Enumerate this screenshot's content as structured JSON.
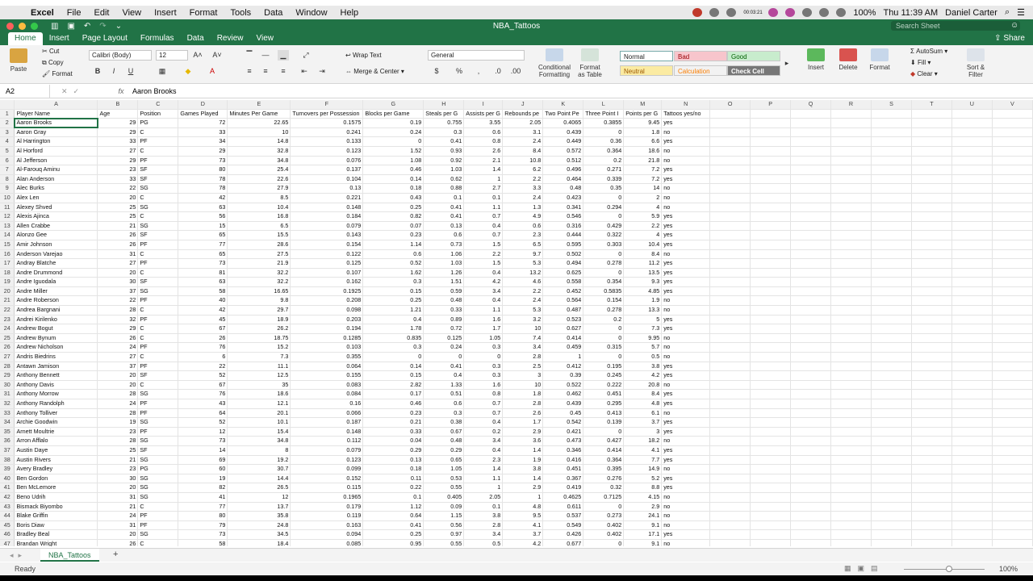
{
  "menubar": {
    "apple": "",
    "app": "Excel",
    "items": [
      "File",
      "Edit",
      "View",
      "Insert",
      "Format",
      "Tools",
      "Data",
      "Window",
      "Help"
    ],
    "battery": "100%",
    "time": "Thu 11:39 AM",
    "user": "Daniel Carter",
    "status_text": "00:03:21"
  },
  "titlebar": {
    "title": "NBA_Tattoos",
    "search_placeholder": "Search Sheet"
  },
  "ribbon_tabs": {
    "items": [
      "Home",
      "Insert",
      "Page Layout",
      "Formulas",
      "Data",
      "Review",
      "View"
    ],
    "share": "Share"
  },
  "ribbon": {
    "paste": "Paste",
    "cut": "Cut",
    "copy": "Copy",
    "format": "Format",
    "font": "Calibri (Body)",
    "size": "12",
    "bold": "B",
    "italic": "I",
    "underline": "U",
    "wrap": "Wrap Text",
    "merge": "Merge & Center",
    "number_format": "General",
    "currency": "$",
    "percent": "%",
    "comma": ",",
    "cond": "Conditional\nFormatting",
    "fmt_table": "Format\nas Table",
    "styles": {
      "normal": "Normal",
      "bad": "Bad",
      "good": "Good",
      "neutral": "Neutral",
      "calculation": "Calculation",
      "check": "Check Cell"
    },
    "insert": "Insert",
    "delete": "Delete",
    "format_cells": "Format",
    "autosum": "AutoSum",
    "fill": "Fill",
    "clear": "Clear",
    "sort": "Sort &\nFilter",
    "colors": {
      "accent": "#217346",
      "bad_bg": "#f7c5cc",
      "good_bg": "#c8eccd",
      "neutral_bg": "#fbeba2",
      "check_bg": "#777777"
    }
  },
  "formula_bar": {
    "name_box": "A2",
    "fx": "fx",
    "value": "Aaron Brooks"
  },
  "grid": {
    "columns": [
      "A",
      "B",
      "C",
      "D",
      "E",
      "F",
      "G",
      "H",
      "I",
      "J",
      "K",
      "L",
      "M",
      "N",
      "O",
      "P",
      "Q",
      "R",
      "S",
      "T",
      "U",
      "V"
    ],
    "header": [
      "Player Name",
      "Age",
      "Position",
      "Games Played",
      "Minutes Per Game",
      "Turnovers per Possession",
      "Blocks per Game",
      "Steals per G",
      "Assists per G",
      "Rebounds pe",
      "Two Point Pe",
      "Three Point I",
      "Points per G",
      "Tattoos yes/no"
    ],
    "rows": [
      [
        "Aaron Brooks",
        "29",
        "PG",
        "72",
        "22.65",
        "0.1575",
        "0.19",
        "0.755",
        "3.55",
        "2.05",
        "0.4065",
        "0.3855",
        "9.45",
        "yes"
      ],
      [
        "Aaron Gray",
        "29",
        "C",
        "33",
        "10",
        "0.241",
        "0.24",
        "0.3",
        "0.6",
        "3.1",
        "0.439",
        "0",
        "1.8",
        "no"
      ],
      [
        "Al Harrington",
        "33",
        "PF",
        "34",
        "14.8",
        "0.133",
        "0",
        "0.41",
        "0.8",
        "2.4",
        "0.449",
        "0.36",
        "6.6",
        "yes"
      ],
      [
        "Al Horford",
        "27",
        "C",
        "29",
        "32.8",
        "0.123",
        "1.52",
        "0.93",
        "2.6",
        "8.4",
        "0.572",
        "0.364",
        "18.6",
        "no"
      ],
      [
        "Al Jefferson",
        "29",
        "PF",
        "73",
        "34.8",
        "0.076",
        "1.08",
        "0.92",
        "2.1",
        "10.8",
        "0.512",
        "0.2",
        "21.8",
        "no"
      ],
      [
        "Al-Farouq Aminu",
        "23",
        "SF",
        "80",
        "25.4",
        "0.137",
        "0.46",
        "1.03",
        "1.4",
        "6.2",
        "0.496",
        "0.271",
        "7.2",
        "yes"
      ],
      [
        "Alan Anderson",
        "33",
        "SF",
        "78",
        "22.6",
        "0.104",
        "0.14",
        "0.62",
        "1",
        "2.2",
        "0.464",
        "0.339",
        "7.2",
        "yes"
      ],
      [
        "Alec Burks",
        "22",
        "SG",
        "78",
        "27.9",
        "0.13",
        "0.18",
        "0.88",
        "2.7",
        "3.3",
        "0.48",
        "0.35",
        "14",
        "no"
      ],
      [
        "Alex Len",
        "20",
        "C",
        "42",
        "8.5",
        "0.221",
        "0.43",
        "0.1",
        "0.1",
        "2.4",
        "0.423",
        "0",
        "2",
        "no"
      ],
      [
        "Alexey Shved",
        "25",
        "SG",
        "63",
        "10.4",
        "0.148",
        "0.25",
        "0.41",
        "1.1",
        "1.3",
        "0.341",
        "0.294",
        "4",
        "no"
      ],
      [
        "Alexis Ajinca",
        "25",
        "C",
        "56",
        "16.8",
        "0.184",
        "0.82",
        "0.41",
        "0.7",
        "4.9",
        "0.546",
        "0",
        "5.9",
        "yes"
      ],
      [
        "Allen Crabbe",
        "21",
        "SG",
        "15",
        "6.5",
        "0.079",
        "0.07",
        "0.13",
        "0.4",
        "0.6",
        "0.316",
        "0.429",
        "2.2",
        "yes"
      ],
      [
        "Alonzo Gee",
        "26",
        "SF",
        "65",
        "15.5",
        "0.143",
        "0.23",
        "0.6",
        "0.7",
        "2.3",
        "0.444",
        "0.322",
        "4",
        "yes"
      ],
      [
        "Amir Johnson",
        "26",
        "PF",
        "77",
        "28.6",
        "0.154",
        "1.14",
        "0.73",
        "1.5",
        "6.5",
        "0.595",
        "0.303",
        "10.4",
        "yes"
      ],
      [
        "Anderson Varejao",
        "31",
        "C",
        "65",
        "27.5",
        "0.122",
        "0.6",
        "1.06",
        "2.2",
        "9.7",
        "0.502",
        "0",
        "8.4",
        "no"
      ],
      [
        "Andray Blatche",
        "27",
        "PF",
        "73",
        "21.9",
        "0.125",
        "0.52",
        "1.03",
        "1.5",
        "5.3",
        "0.494",
        "0.278",
        "11.2",
        "yes"
      ],
      [
        "Andre Drummond",
        "20",
        "C",
        "81",
        "32.2",
        "0.107",
        "1.62",
        "1.26",
        "0.4",
        "13.2",
        "0.625",
        "0",
        "13.5",
        "yes"
      ],
      [
        "Andre Iguodala",
        "30",
        "SF",
        "63",
        "32.2",
        "0.162",
        "0.3",
        "1.51",
        "4.2",
        "4.6",
        "0.558",
        "0.354",
        "9.3",
        "yes"
      ],
      [
        "Andre Miller",
        "37",
        "SG",
        "58",
        "16.65",
        "0.1925",
        "0.15",
        "0.59",
        "3.4",
        "2.2",
        "0.452",
        "0.5835",
        "4.85",
        "yes"
      ],
      [
        "Andre Roberson",
        "22",
        "PF",
        "40",
        "9.8",
        "0.208",
        "0.25",
        "0.48",
        "0.4",
        "2.4",
        "0.564",
        "0.154",
        "1.9",
        "no"
      ],
      [
        "Andrea Bargnani",
        "28",
        "C",
        "42",
        "29.7",
        "0.098",
        "1.21",
        "0.33",
        "1.1",
        "5.3",
        "0.487",
        "0.278",
        "13.3",
        "no"
      ],
      [
        "Andrei Kirilenko",
        "32",
        "PF",
        "45",
        "18.9",
        "0.203",
        "0.4",
        "0.89",
        "1.6",
        "3.2",
        "0.523",
        "0.2",
        "5",
        "yes"
      ],
      [
        "Andrew Bogut",
        "29",
        "C",
        "67",
        "26.2",
        "0.194",
        "1.78",
        "0.72",
        "1.7",
        "10",
        "0.627",
        "0",
        "7.3",
        "yes"
      ],
      [
        "Andrew Bynum",
        "26",
        "C",
        "26",
        "18.75",
        "0.1285",
        "0.835",
        "0.125",
        "1.05",
        "7.4",
        "0.414",
        "0",
        "9.95",
        "no"
      ],
      [
        "Andrew Nicholson",
        "24",
        "PF",
        "76",
        "15.2",
        "0.103",
        "0.3",
        "0.24",
        "0.3",
        "3.4",
        "0.459",
        "0.315",
        "5.7",
        "no"
      ],
      [
        "Andris Biedrins",
        "27",
        "C",
        "6",
        "7.3",
        "0.355",
        "0",
        "0",
        "0",
        "2.8",
        "1",
        "0",
        "0.5",
        "no"
      ],
      [
        "Antawn Jamison",
        "37",
        "PF",
        "22",
        "11.1",
        "0.064",
        "0.14",
        "0.41",
        "0.3",
        "2.5",
        "0.412",
        "0.195",
        "3.8",
        "yes"
      ],
      [
        "Anthony Bennett",
        "20",
        "SF",
        "52",
        "12.5",
        "0.155",
        "0.15",
        "0.4",
        "0.3",
        "3",
        "0.39",
        "0.245",
        "4.2",
        "yes"
      ],
      [
        "Anthony Davis",
        "20",
        "C",
        "67",
        "35",
        "0.083",
        "2.82",
        "1.33",
        "1.6",
        "10",
        "0.522",
        "0.222",
        "20.8",
        "no"
      ],
      [
        "Anthony Morrow",
        "28",
        "SG",
        "76",
        "18.6",
        "0.084",
        "0.17",
        "0.51",
        "0.8",
        "1.8",
        "0.462",
        "0.451",
        "8.4",
        "yes"
      ],
      [
        "Anthony Randolph",
        "24",
        "PF",
        "43",
        "12.1",
        "0.16",
        "0.46",
        "0.6",
        "0.7",
        "2.8",
        "0.439",
        "0.295",
        "4.8",
        "yes"
      ],
      [
        "Anthony Tolliver",
        "28",
        "PF",
        "64",
        "20.1",
        "0.066",
        "0.23",
        "0.3",
        "0.7",
        "2.6",
        "0.45",
        "0.413",
        "6.1",
        "no"
      ],
      [
        "Archie Goodwin",
        "19",
        "SG",
        "52",
        "10.1",
        "0.187",
        "0.21",
        "0.38",
        "0.4",
        "1.7",
        "0.542",
        "0.139",
        "3.7",
        "yes"
      ],
      [
        "Arnett Moultrie",
        "23",
        "PF",
        "12",
        "15.4",
        "0.148",
        "0.33",
        "0.67",
        "0.2",
        "2.9",
        "0.421",
        "0",
        "3",
        "yes"
      ],
      [
        "Arron Afflalo",
        "28",
        "SG",
        "73",
        "34.8",
        "0.112",
        "0.04",
        "0.48",
        "3.4",
        "3.6",
        "0.473",
        "0.427",
        "18.2",
        "no"
      ],
      [
        "Austin Daye",
        "25",
        "SF",
        "14",
        "8",
        "0.079",
        "0.29",
        "0.29",
        "0.4",
        "1.4",
        "0.346",
        "0.414",
        "4.1",
        "yes"
      ],
      [
        "Austin Rivers",
        "21",
        "SG",
        "69",
        "19.2",
        "0.123",
        "0.13",
        "0.65",
        "2.3",
        "1.9",
        "0.416",
        "0.364",
        "7.7",
        "yes"
      ],
      [
        "Avery Bradley",
        "23",
        "PG",
        "60",
        "30.7",
        "0.099",
        "0.18",
        "1.05",
        "1.4",
        "3.8",
        "0.451",
        "0.395",
        "14.9",
        "no"
      ],
      [
        "Ben Gordon",
        "30",
        "SG",
        "19",
        "14.4",
        "0.152",
        "0.11",
        "0.53",
        "1.1",
        "1.4",
        "0.367",
        "0.276",
        "5.2",
        "yes"
      ],
      [
        "Ben McLemore",
        "20",
        "SG",
        "82",
        "26.5",
        "0.115",
        "0.22",
        "0.55",
        "1",
        "2.9",
        "0.419",
        "0.32",
        "8.8",
        "yes"
      ],
      [
        "Beno Udrih",
        "31",
        "SG",
        "41",
        "12",
        "0.1965",
        "0.1",
        "0.405",
        "2.05",
        "1",
        "0.4625",
        "0.7125",
        "4.15",
        "no"
      ],
      [
        "Bismack Biyombo",
        "21",
        "C",
        "77",
        "13.7",
        "0.179",
        "1.12",
        "0.09",
        "0.1",
        "4.8",
        "0.611",
        "0",
        "2.9",
        "no"
      ],
      [
        "Blake Griffin",
        "24",
        "PF",
        "80",
        "35.8",
        "0.119",
        "0.64",
        "1.15",
        "3.8",
        "9.5",
        "0.537",
        "0.273",
        "24.1",
        "no"
      ],
      [
        "Boris Diaw",
        "31",
        "PF",
        "79",
        "24.8",
        "0.163",
        "0.41",
        "0.56",
        "2.8",
        "4.1",
        "0.549",
        "0.402",
        "9.1",
        "no"
      ],
      [
        "Bradley Beal",
        "20",
        "SG",
        "73",
        "34.5",
        "0.094",
        "0.25",
        "0.97",
        "3.4",
        "3.7",
        "0.426",
        "0.402",
        "17.1",
        "yes"
      ],
      [
        "Brandan Wright",
        "26",
        "C",
        "58",
        "18.4",
        "0.085",
        "0.95",
        "0.55",
        "0.5",
        "4.2",
        "0.677",
        "0",
        "9.1",
        "no"
      ],
      [
        "Brandon Bass",
        "28",
        "PF",
        "82",
        "27.5",
        "0.109",
        "0.87",
        "0.44",
        "1.1",
        "5.7",
        "0.487",
        "0.333",
        "11.1",
        "yes"
      ],
      [
        "Brandon Davies",
        "22",
        "PF",
        "51",
        "11.1",
        "0.188",
        "0.16",
        "0.47",
        "0.5",
        "2.1",
        "0.441",
        "0.2",
        "2.8",
        "no"
      ],
      [
        "Brandon Jennings",
        "24",
        "PG",
        "80",
        "33.9",
        "0.144",
        "0.1",
        "1.26",
        "7.6",
        "3.1",
        "0.397",
        "0.337",
        "15.5",
        "yes"
      ]
    ]
  },
  "sheet": {
    "tab": "NBA_Tattoos",
    "add": "+"
  },
  "status": {
    "text": "Ready",
    "zoom": "100%"
  }
}
